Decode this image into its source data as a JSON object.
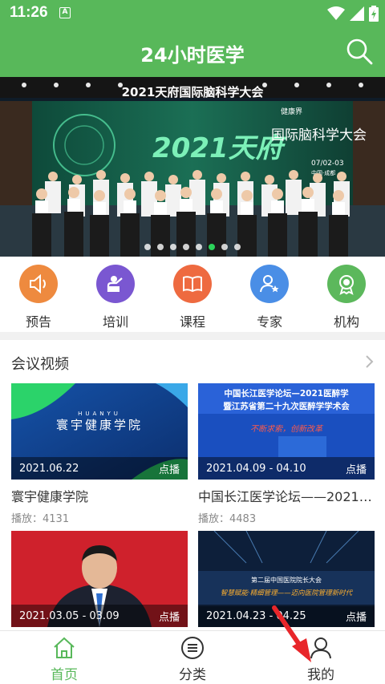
{
  "status_bar": {
    "time": "11:26",
    "notification_letter": "A"
  },
  "app_bar": {
    "title": "24小时医学"
  },
  "banner": {
    "headline": "2021天府国际脑科学大会",
    "slogan": "2021天府",
    "event_name": "国际脑科学大会",
    "brand": "健康界",
    "date": "07/02-03",
    "city": "中国·成都",
    "slide_count": 8,
    "active_slide": 6
  },
  "shortcuts": [
    {
      "label": "预告",
      "color": "#ee8a3f",
      "icon": "speaker-icon"
    },
    {
      "label": "培训",
      "color": "#7a57d1",
      "icon": "trainer-icon"
    },
    {
      "label": "课程",
      "color": "#ee6a40",
      "icon": "book-icon"
    },
    {
      "label": "专家",
      "color": "#4a8ee6",
      "icon": "expert-icon"
    },
    {
      "label": "机构",
      "color": "#5cb85c",
      "icon": "award-icon"
    }
  ],
  "section": {
    "title": "会议视频",
    "cards": [
      {
        "title": "寰宇健康学院",
        "date": "2021.06.22",
        "tag": "点播",
        "views": "播放：4131",
        "thumb_brand": "HUANYU",
        "thumb_title": "寰宇健康学院"
      },
      {
        "title": "中国长江医学论坛——2021…",
        "date": "2021.04.09 - 04.10",
        "tag": "点播",
        "views": "播放：4483",
        "thumb_line1": "中国长江医学论坛—2021医醉学",
        "thumb_line2": "暨江苏省第二十九次医醉学学术会",
        "thumb_slogan": "不断求索，创新改革"
      },
      {
        "title": "",
        "date": "2021.03.05 - 03.09",
        "tag": "点播",
        "views": ""
      },
      {
        "title": "",
        "date": "2021.04.23 - 04.25",
        "tag": "点播",
        "views": "",
        "thumb_line1": "第二届中国医院院长大会",
        "thumb_line2": "智慧赋能·精细管理——迈向医院管理新时代"
      }
    ]
  },
  "tabs": [
    {
      "label": "首页",
      "icon": "home-icon",
      "active": true
    },
    {
      "label": "分类",
      "icon": "menu-icon",
      "active": false
    },
    {
      "label": "我的",
      "icon": "user-icon",
      "active": false
    }
  ],
  "colors": {
    "brand_green": "#58b85a",
    "annotation_arrow": "#e8262a"
  }
}
